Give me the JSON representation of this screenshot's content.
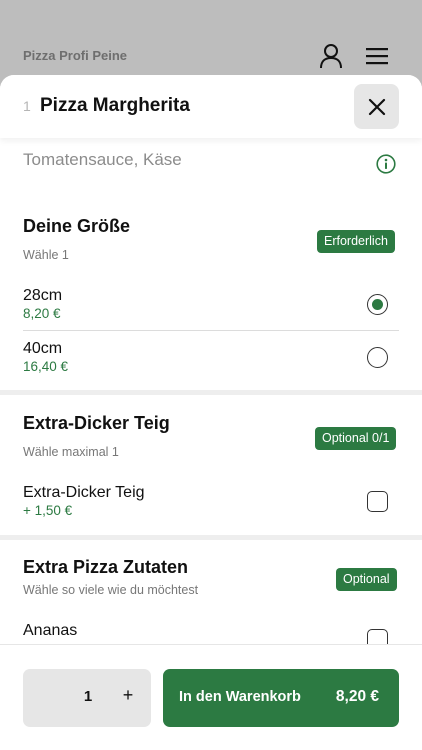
{
  "restaurant": {
    "name": "Pizza Profi Peine"
  },
  "product": {
    "quantity_prefix": "1",
    "title": "Pizza Margherita",
    "description": "Tomatensauce, Käse"
  },
  "sections": {
    "size": {
      "title": "Deine Größe",
      "subtitle": "Wähle 1",
      "badge": "Erforderlich",
      "options": [
        {
          "name": "28cm",
          "price": "8,20 €",
          "selected": true
        },
        {
          "name": "40cm",
          "price": "16,40 €",
          "selected": false
        }
      ]
    },
    "dough": {
      "title": "Extra-Dicker Teig",
      "subtitle": "Wähle maximal 1",
      "badge": "Optional 0/1",
      "options": [
        {
          "name": "Extra-Dicker Teig",
          "price": "+ 1,50 €",
          "checked": false
        }
      ]
    },
    "toppings": {
      "title": "Extra Pizza Zutaten",
      "subtitle": "Wähle so viele wie du möchtest",
      "badge": "Optional",
      "options": [
        {
          "name": "Ananas",
          "checked": false
        }
      ]
    }
  },
  "footer": {
    "quantity": "1",
    "plus_label": "+",
    "cart_label": "In den Warenkorb",
    "cart_price": "8,20 €"
  },
  "colors": {
    "accent": "#2c7a42",
    "sheet": "#ffffff",
    "backdrop": "#bdbdbd"
  },
  "icons": [
    "user-icon",
    "menu-icon",
    "close-icon",
    "info-icon"
  ]
}
